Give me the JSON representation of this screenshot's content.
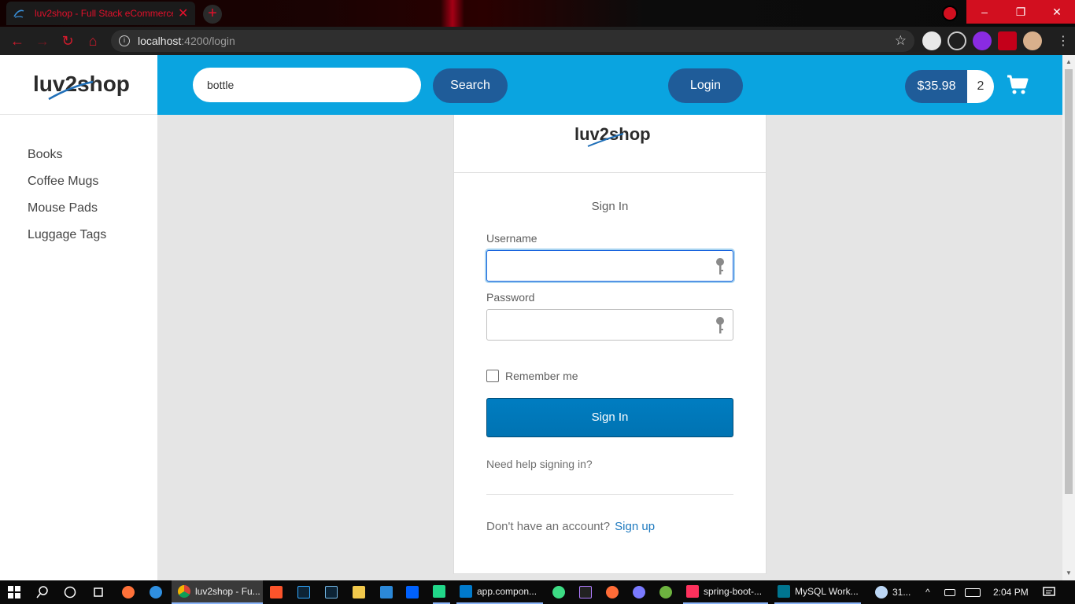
{
  "browser": {
    "tab_title": "luv2shop - Full Stack eCommerce",
    "tab_close": "✕",
    "new_tab": "+",
    "url_host": "localhost",
    "url_rest": ":4200/login",
    "win_minimize": "–",
    "win_restore": "❐",
    "win_close": "✕",
    "back": "←",
    "forward": "→",
    "reload": "↻",
    "home": "⌂",
    "star": "☆",
    "menu": "⋮"
  },
  "brand": {
    "logo_text": "luv2shop"
  },
  "sidebar": {
    "items": [
      {
        "label": "Books"
      },
      {
        "label": "Coffee Mugs"
      },
      {
        "label": "Mouse Pads"
      },
      {
        "label": "Luggage Tags"
      }
    ]
  },
  "header": {
    "search_value": "bottle",
    "search_label": "Search",
    "login_label": "Login",
    "cart_total": "$35.98",
    "cart_quantity": "2"
  },
  "login_card": {
    "logo_text": "luv2shop",
    "title": "Sign In",
    "username_label": "Username",
    "username_value": "",
    "password_label": "Password",
    "password_value": "",
    "remember_label": "Remember me",
    "submit_label": "Sign In",
    "help_link": "Need help signing in?",
    "signup_prompt": "Don't have an account?",
    "signup_link": "Sign up"
  },
  "taskbar": {
    "chrome_label": "luv2shop - Fu...",
    "vscode_label": "app.compon...",
    "intellij_label": "spring-boot-...",
    "mysql_label": "MySQL Work...",
    "weather": "31...",
    "time": "2:04 PM"
  },
  "colors": {
    "header_blue": "#0aa4e0",
    "pill_blue": "#1f5c99",
    "signin_blue": "#007dc1",
    "link_blue": "#1f7abf",
    "chrome_red": "#d20f1f"
  }
}
